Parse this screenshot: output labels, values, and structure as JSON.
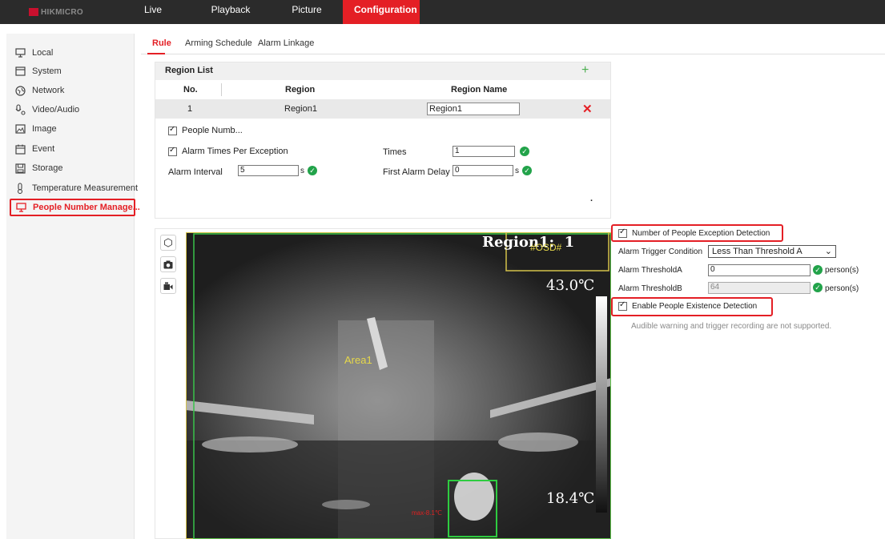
{
  "brand": {
    "logo_text": "HIKMICRO"
  },
  "top_nav": [
    "Live View",
    "Playback",
    "Picture",
    "Configuration"
  ],
  "sidebar": [
    {
      "label": "Local",
      "icon": "monitor-icon"
    },
    {
      "label": "System",
      "icon": "system-icon"
    },
    {
      "label": "Network",
      "icon": "network-icon"
    },
    {
      "label": "Video/Audio",
      "icon": "video-audio-icon"
    },
    {
      "label": "Image",
      "icon": "image-icon"
    },
    {
      "label": "Event",
      "icon": "event-icon"
    },
    {
      "label": "Storage",
      "icon": "storage-icon"
    },
    {
      "label": "Temperature Measurement",
      "icon": "thermometer-icon"
    },
    {
      "label": "People Number Manage...",
      "icon": "monitor-icon"
    }
  ],
  "sub_tabs": [
    "Rule",
    "Arming Schedule",
    "Alarm Linkage"
  ],
  "region_list": {
    "title": "Region List",
    "columns": [
      "No.",
      "Region",
      "Region Name"
    ],
    "rows": [
      {
        "no": "1",
        "region": "Region1",
        "name": "Region1"
      }
    ]
  },
  "form": {
    "people_number_label": "People Numb...",
    "alarm_times_label": "Alarm Times Per Exception",
    "times_label": "Times",
    "times_value": "1",
    "alarm_interval_label": "Alarm Interval",
    "alarm_interval_value": "5",
    "interval_unit": "s",
    "first_alarm_delay_label": "First Alarm Delay",
    "first_alarm_delay_value": "0",
    "delay_unit": "s",
    "dot": "."
  },
  "video": {
    "region_overlay": "Region1:  1",
    "osd_overlay": "#OSD#",
    "temp_high": "43.0℃",
    "temp_low": "18.4℃",
    "area_label": "Area1",
    "spot_label": "max-8.1℃"
  },
  "detection": {
    "exception_label": "Number of People Exception Detection",
    "trigger_label": "Alarm Trigger Condition",
    "trigger_value": "Less Than Threshold A",
    "threshold_a_label": "Alarm ThresholdA",
    "threshold_a_value": "0",
    "threshold_b_label": "Alarm ThresholdB",
    "threshold_b_value": "64",
    "unit": "person(s)",
    "existence_label": "Enable People Existence Detection",
    "note": "Audible warning and trigger recording are not supported."
  },
  "colors": {
    "accent": "#e41f25",
    "ok_green": "#22a34a",
    "topbar": "#2b2b2b"
  }
}
